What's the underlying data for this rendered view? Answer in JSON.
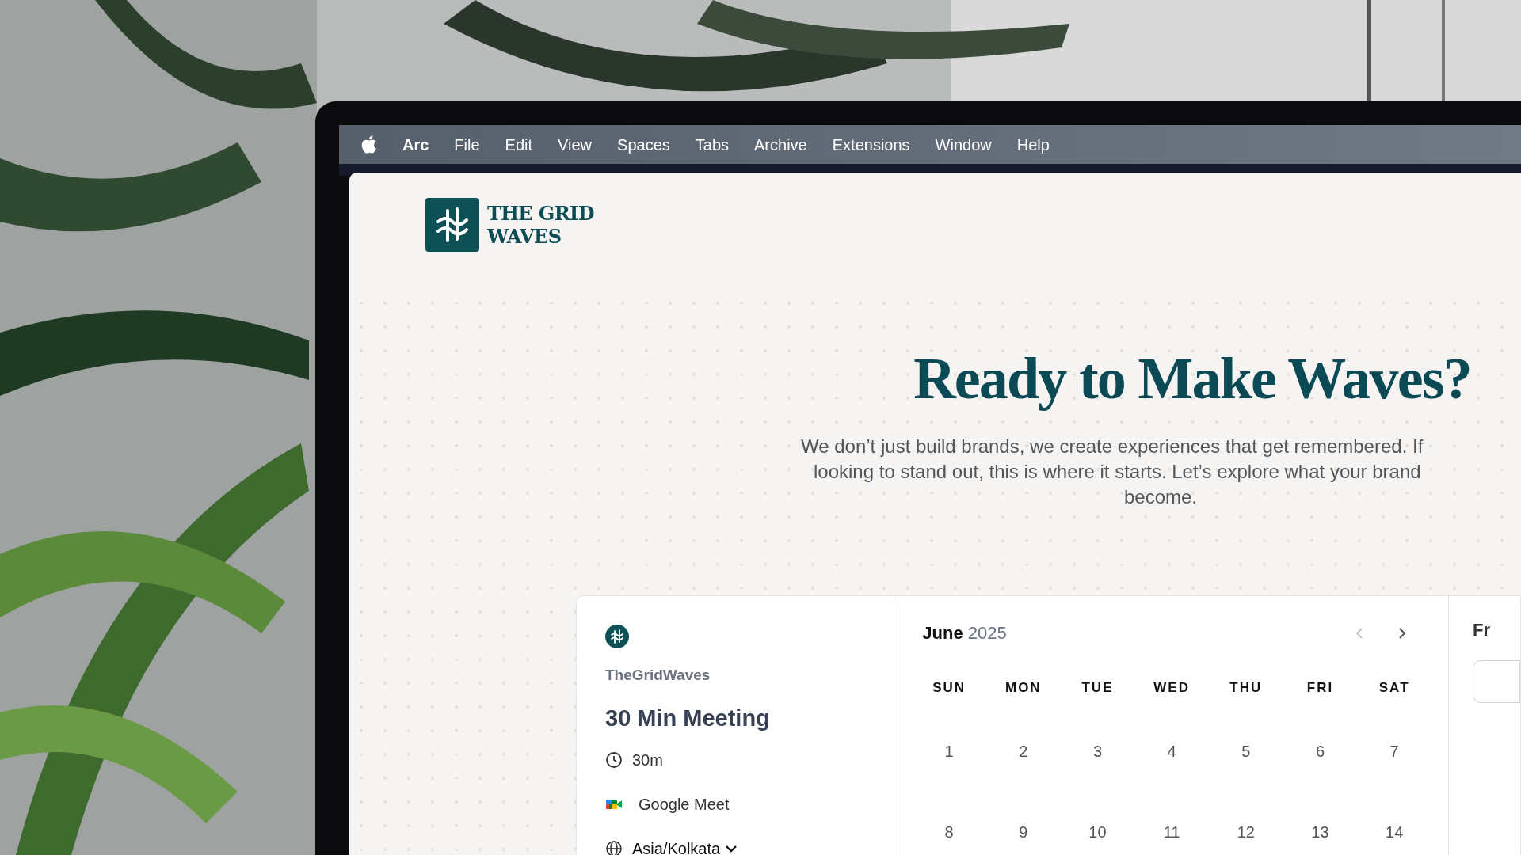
{
  "menu_bar": {
    "items": [
      {
        "label": "Arc",
        "kind": "app"
      },
      {
        "label": "File",
        "kind": "menu"
      },
      {
        "label": "Edit",
        "kind": "menu"
      },
      {
        "label": "View",
        "kind": "menu"
      },
      {
        "label": "Spaces",
        "kind": "menu"
      },
      {
        "label": "Tabs",
        "kind": "menu"
      },
      {
        "label": "Archive",
        "kind": "menu"
      },
      {
        "label": "Extensions",
        "kind": "menu"
      },
      {
        "label": "Window",
        "kind": "menu"
      },
      {
        "label": "Help",
        "kind": "menu"
      }
    ]
  },
  "logo": {
    "lines": [
      "THE GRID",
      "WAVES"
    ]
  },
  "hero": {
    "title": "Ready to Make Waves?",
    "lines": [
      "We don’t just build brands, we create experiences that get remembered. If",
      "looking to stand out, this is where it starts. Let’s explore what your brand",
      "become."
    ]
  },
  "booking": {
    "organizer": "TheGridWaves",
    "event": "30 Min Meeting",
    "details": [
      {
        "kind": "duration",
        "label": "30m"
      },
      {
        "kind": "video",
        "label": "Google Meet"
      },
      {
        "kind": "timezone",
        "label": "Asia/Kolkata"
      }
    ],
    "calendar": {
      "month": "June",
      "year": "2025",
      "weekdays": [
        "SUN",
        "MON",
        "TUE",
        "WED",
        "THU",
        "FRI",
        "SAT"
      ],
      "weeks": [
        [
          "1",
          "2",
          "3",
          "4",
          "5",
          "6",
          "7"
        ],
        [
          "8",
          "9",
          "10",
          "11",
          "12",
          "13",
          "14"
        ]
      ]
    },
    "side_panel": {
      "heading": "Fr"
    }
  }
}
